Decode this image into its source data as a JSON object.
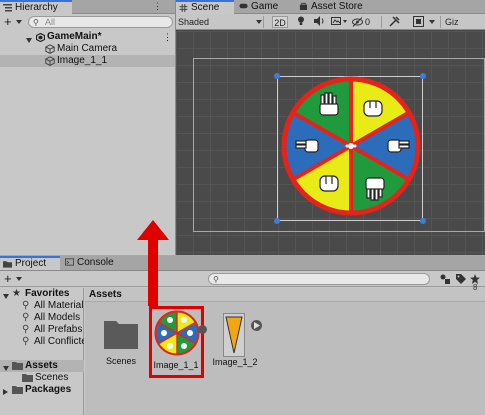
{
  "hierarchy": {
    "tab_label": "Hierarchy",
    "search_placeholder": "All",
    "items": [
      {
        "label": "GameMain*"
      },
      {
        "label": "Main Camera"
      },
      {
        "label": "Image_1_1"
      }
    ]
  },
  "scene": {
    "tabs": [
      {
        "label": "Scene"
      },
      {
        "label": "Game"
      },
      {
        "label": "Asset Store"
      }
    ],
    "shading_mode": "Shaded",
    "mode_2d": "2D",
    "gizmos_label": "Giz",
    "hidden_count": "0",
    "wheel_colors": [
      "#e9eb16",
      "#1f9a3c",
      "#2c6dbb"
    ]
  },
  "project": {
    "tabs": [
      {
        "label": "Project"
      },
      {
        "label": "Console"
      }
    ],
    "favorites": {
      "label": "Favorites",
      "items": [
        {
          "label": "All Materials"
        },
        {
          "label": "All Models"
        },
        {
          "label": "All Prefabs"
        },
        {
          "label": "All Conflicted"
        }
      ]
    },
    "tree": {
      "assets_label": "Assets",
      "scenes_label": "Scenes",
      "packages_label": "Packages"
    },
    "breadcrumb": "Assets",
    "assets": [
      {
        "label": "Scenes",
        "icon": "folder-icon"
      },
      {
        "label": "Image_1_1",
        "icon": "wheel-thumbnail"
      },
      {
        "label": "Image_1_2",
        "icon": "pointer-thumbnail"
      }
    ],
    "badge_count": "8"
  },
  "annotation": {
    "highlight_color": "#e00000"
  }
}
